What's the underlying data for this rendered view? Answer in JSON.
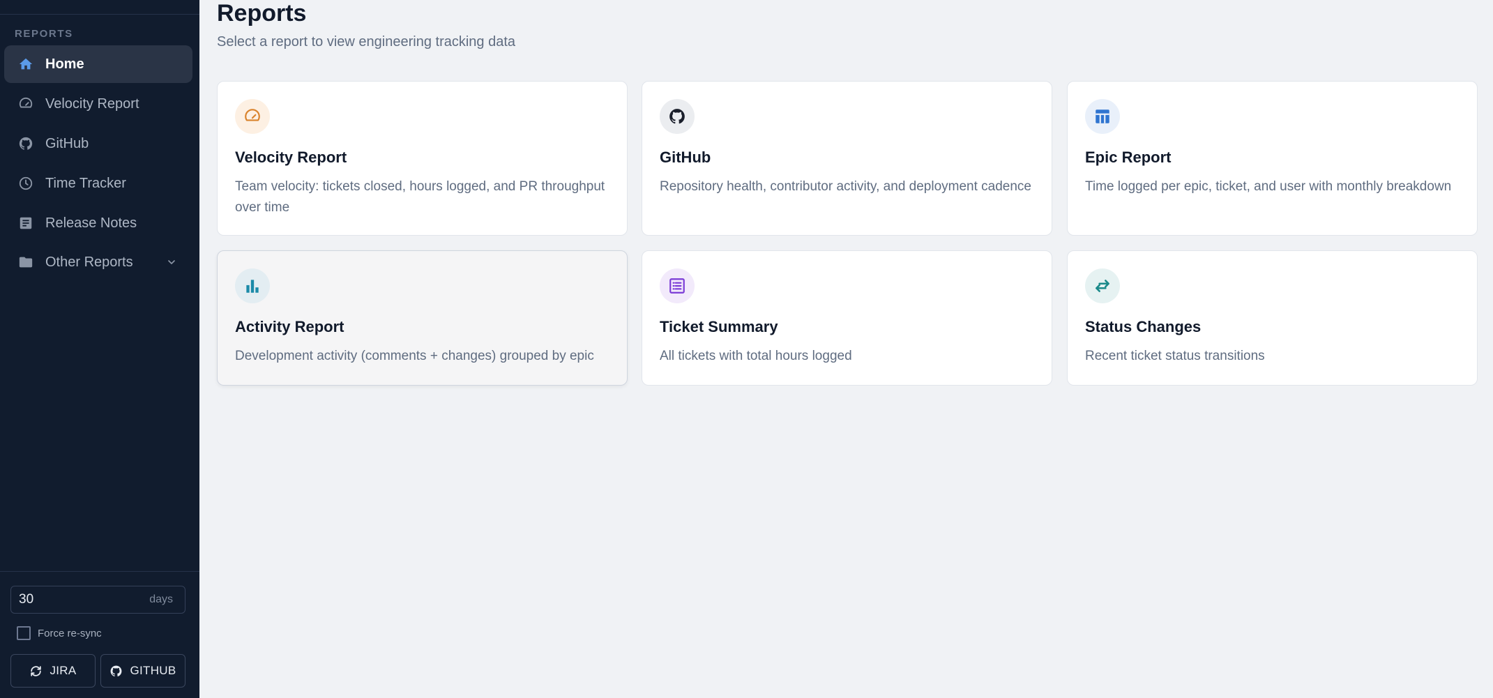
{
  "sidebar": {
    "section_label": "REPORTS",
    "items": [
      {
        "label": "Home",
        "icon": "home-icon",
        "active": true
      },
      {
        "label": "Velocity Report",
        "icon": "speedometer-icon"
      },
      {
        "label": "GitHub",
        "icon": "github-icon"
      },
      {
        "label": "Time Tracker",
        "icon": "clock-icon"
      },
      {
        "label": "Release Notes",
        "icon": "document-icon"
      },
      {
        "label": "Other Reports",
        "icon": "folder-icon",
        "expandable": true
      }
    ],
    "days_value": "30",
    "days_unit": "days",
    "force_resync_label": "Force re-sync",
    "force_resync_checked": false,
    "jira_button": "JIRA",
    "github_button": "GITHUB"
  },
  "main": {
    "title": "Reports",
    "subtitle": "Select a report to view engineering tracking data",
    "cards": [
      {
        "title": "Velocity Report",
        "description": "Team velocity: tickets closed, hours logged, and PR throughput over time",
        "icon": "speedometer-icon",
        "accent": "#d9822b",
        "icon_bg": "#fdf0e3"
      },
      {
        "title": "GitHub",
        "description": "Repository health, contributor activity, and deployment cadence",
        "icon": "github-icon",
        "accent": "#1a1f2b",
        "icon_bg": "#ebedf0"
      },
      {
        "title": "Epic Report",
        "description": "Time logged per epic, ticket, and user with monthly breakdown",
        "icon": "table-icon",
        "accent": "#2f74d0",
        "icon_bg": "#e9f0fa"
      },
      {
        "title": "Activity Report",
        "description": "Development activity (comments + changes) grouped by epic",
        "icon": "bar-chart-icon",
        "accent": "#1b8aa8",
        "icon_bg": "#e3edf2"
      },
      {
        "title": "Ticket Summary",
        "description": "All tickets with total hours logged",
        "icon": "list-icon",
        "accent": "#7a3bd6",
        "icon_bg": "#f2eafb"
      },
      {
        "title": "Status Changes",
        "description": "Recent ticket status transitions",
        "icon": "swap-arrows-icon",
        "accent": "#1b8a8a",
        "icon_bg": "#e6f2f2"
      }
    ]
  }
}
